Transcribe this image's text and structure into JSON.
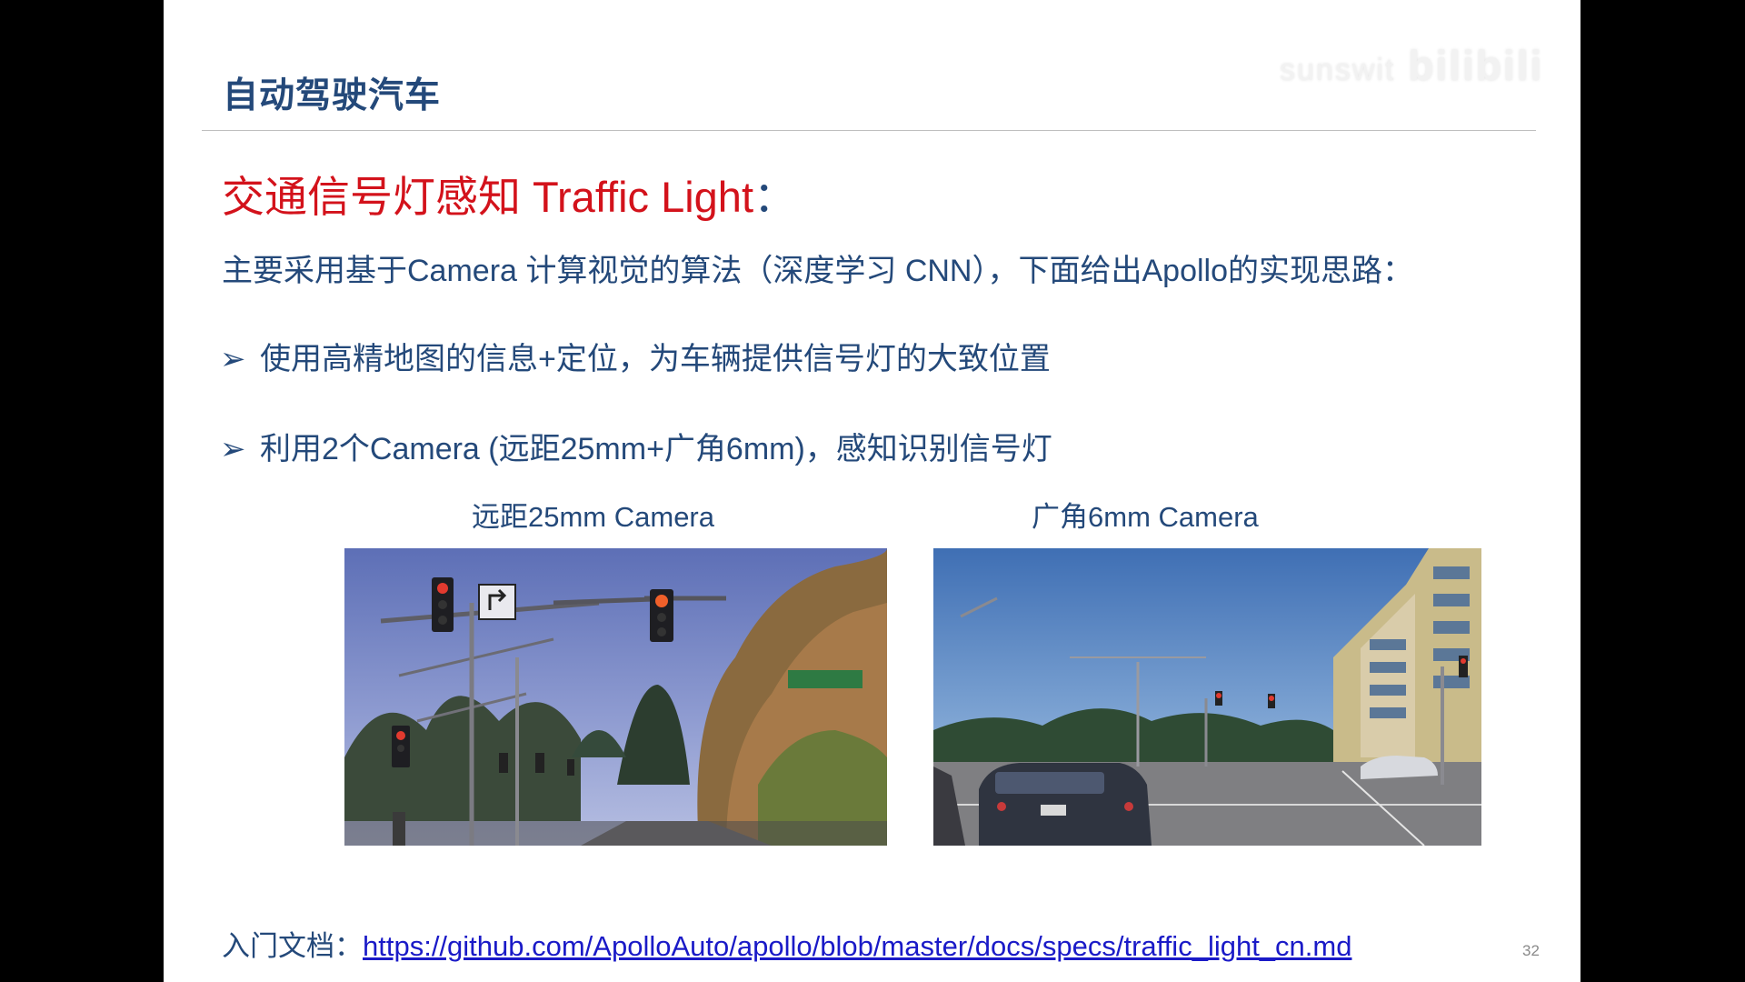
{
  "slide": {
    "title": "自动驾驶汽车",
    "watermark": {
      "site": "sunswit",
      "logo": "bilibili"
    },
    "heading": "交通信号灯感知 Traffic Light",
    "heading_colon": "：",
    "intro": "主要采用基于Camera 计算视觉的算法（深度学习 CNN），下面给出Apollo的实现思路：",
    "bullet_symbol": "➢",
    "bullets": [
      "使用高精地图的信息+定位，为车辆提供信号灯的大致位置",
      "利用2个Camera (远距25mm+广角6mm)，感知识别信号灯"
    ],
    "captions": [
      "远距25mm Camera",
      "广角6mm Camera"
    ],
    "doc_label": "入门文档：",
    "doc_link": "https://github.com/ApolloAuto/apollo/blob/master/docs/specs/traffic_light_cn.md",
    "page_number": "32"
  }
}
